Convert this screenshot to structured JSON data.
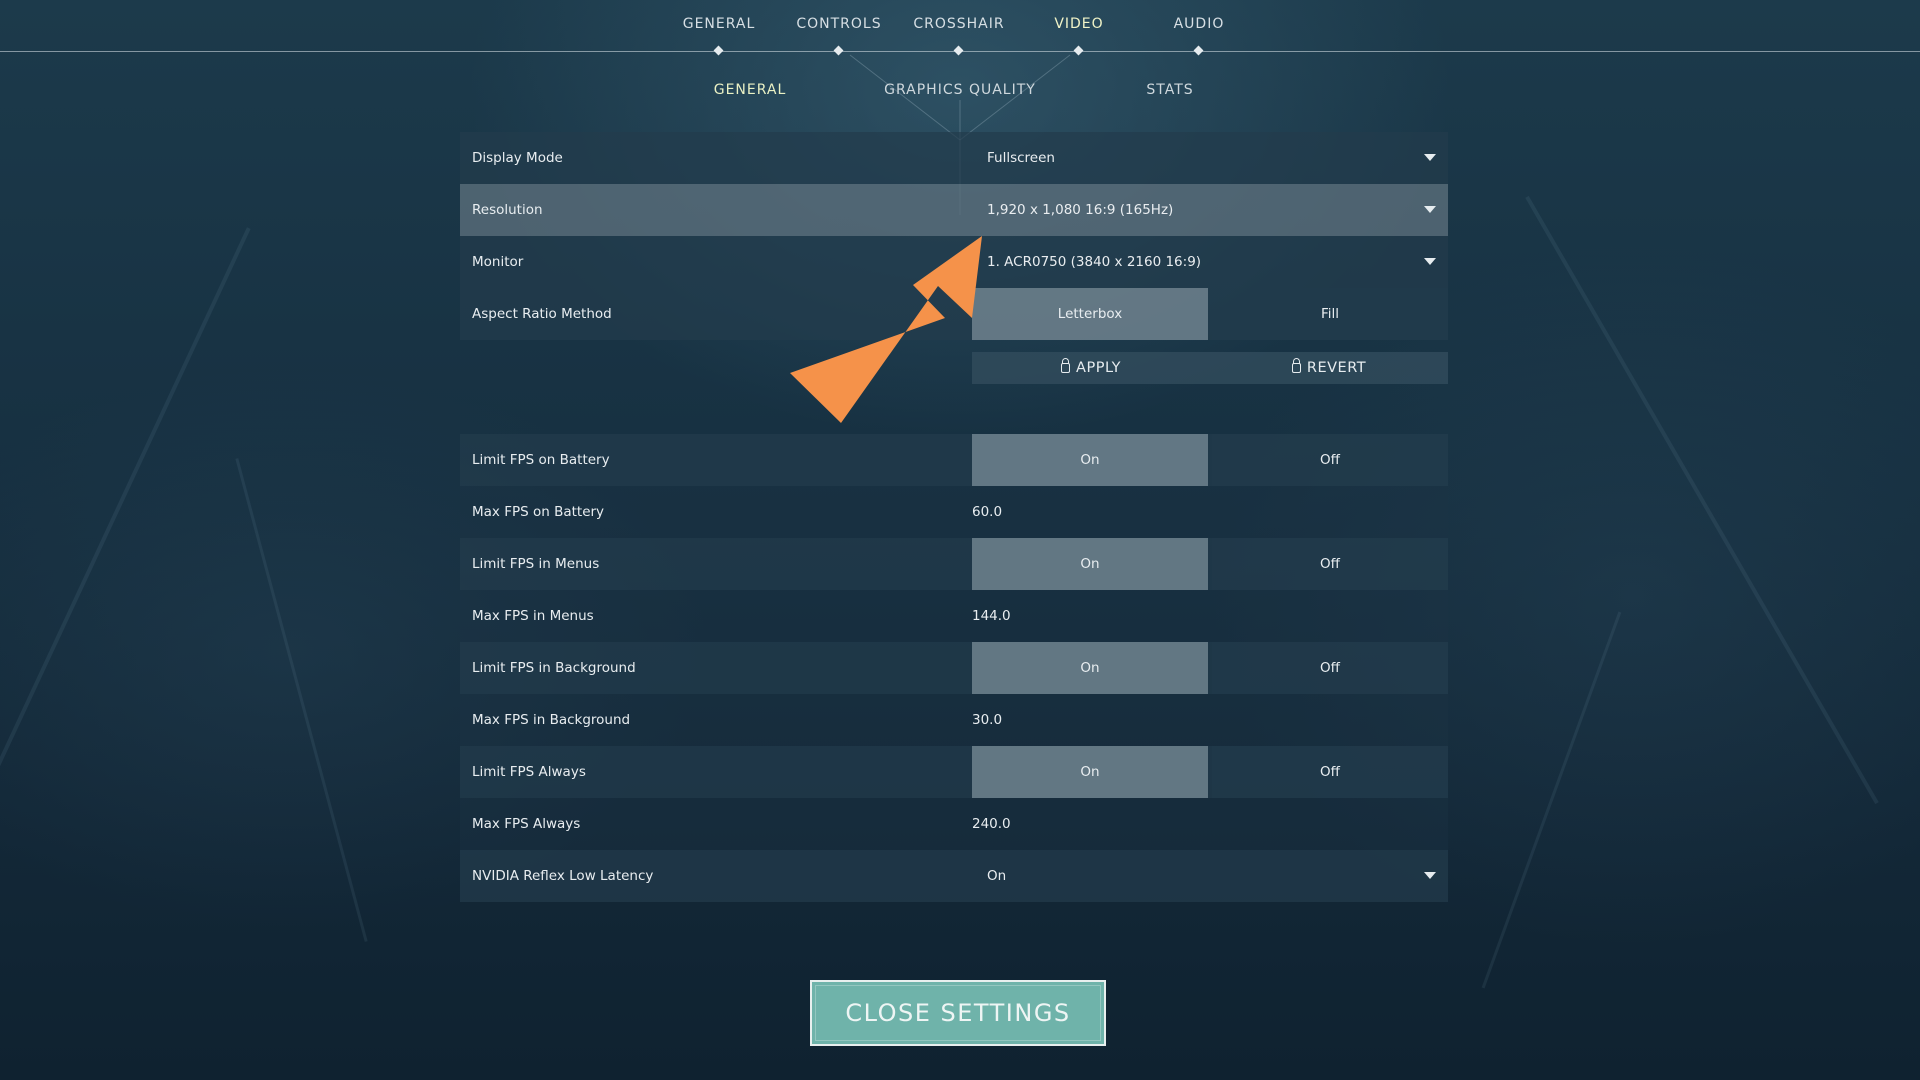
{
  "tabs": {
    "top": [
      "GENERAL",
      "CONTROLS",
      "CROSSHAIR",
      "VIDEO",
      "AUDIO"
    ],
    "active_top": "VIDEO",
    "sub": [
      "GENERAL",
      "GRAPHICS QUALITY",
      "STATS"
    ],
    "active_sub": "GENERAL"
  },
  "settings": {
    "display_mode": {
      "label": "Display Mode",
      "value": "Fullscreen"
    },
    "resolution": {
      "label": "Resolution",
      "value": "1,920 x 1,080 16:9 (165Hz)"
    },
    "monitor": {
      "label": "Monitor",
      "value": "1. ACR0750 (3840 x  2160 16:9)"
    },
    "aspect_ratio": {
      "label": "Aspect Ratio Method",
      "options": [
        "Letterbox",
        "Fill"
      ],
      "selected": "Letterbox"
    },
    "apply_label": "APPLY",
    "revert_label": "REVERT",
    "limit_fps_battery": {
      "label": "Limit FPS on Battery",
      "on": "On",
      "off": "Off",
      "selected": "On"
    },
    "max_fps_battery": {
      "label": "Max FPS on Battery",
      "value": "60.0"
    },
    "limit_fps_menus": {
      "label": "Limit FPS in Menus",
      "on": "On",
      "off": "Off",
      "selected": "On"
    },
    "max_fps_menus": {
      "label": "Max FPS in Menus",
      "value": "144.0"
    },
    "limit_fps_background": {
      "label": "Limit FPS in Background",
      "on": "On",
      "off": "Off",
      "selected": "On"
    },
    "max_fps_background": {
      "label": "Max FPS in Background",
      "value": "30.0"
    },
    "limit_fps_always": {
      "label": "Limit FPS Always",
      "on": "On",
      "off": "Off",
      "selected": "On"
    },
    "max_fps_always": {
      "label": "Max FPS Always",
      "value": "240.0"
    },
    "nvidia_reflex": {
      "label": "NVIDIA Reflex Low Latency",
      "value": "On"
    }
  },
  "close_button": "CLOSE SETTINGS",
  "icons": {
    "dropdown": "chevron-down-icon",
    "lock": "lock-icon",
    "annotation": "arrow-annotation"
  },
  "colors": {
    "accent_active_tab": "#f1f4c8",
    "close_button": "#6fb3aa",
    "arrow": "#f5924a"
  }
}
